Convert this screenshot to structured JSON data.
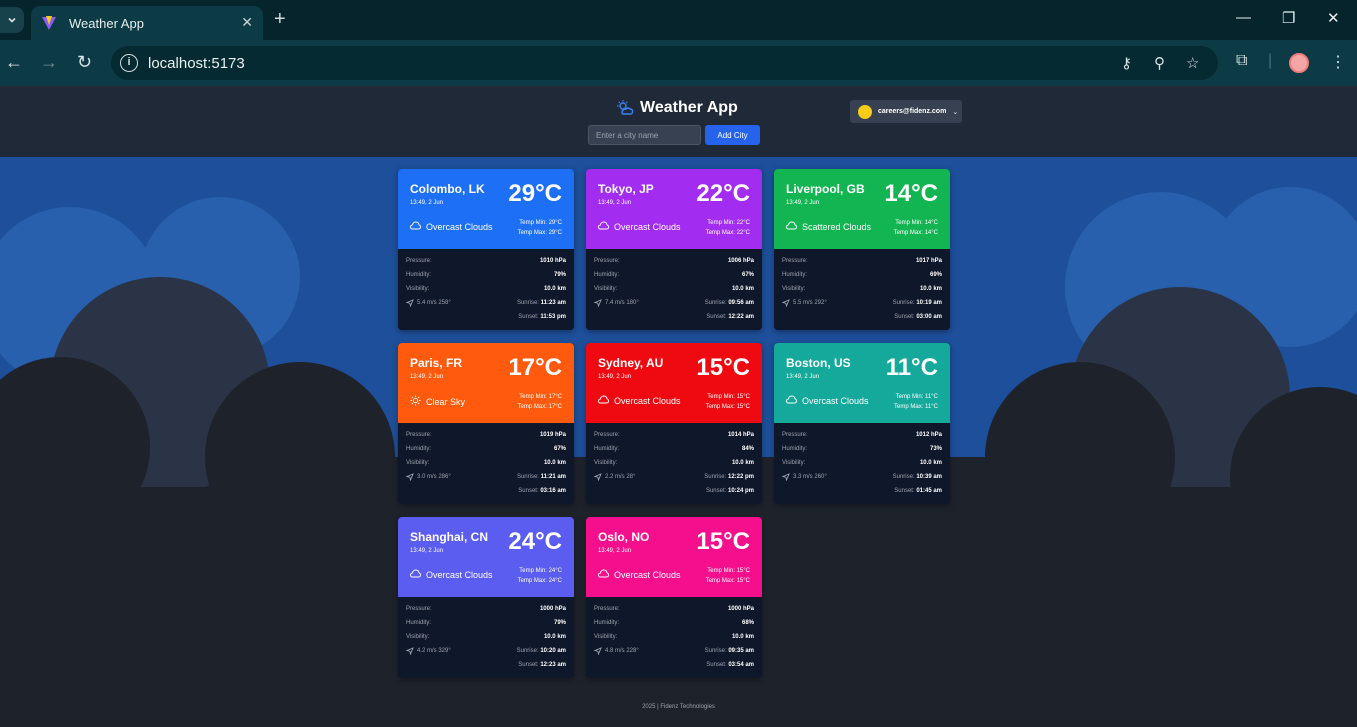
{
  "browser": {
    "tab_title": "Weather App",
    "url": "localhost:5173"
  },
  "app": {
    "title": "Weather App",
    "search_placeholder": "Enter a city name",
    "add_button": "Add City",
    "user_email": "careers@fidenz.com"
  },
  "labels": {
    "pressure": "Pressure:",
    "humidity": "Humidity:",
    "visibility": "Visibility:",
    "sunrise": "Sunrise:",
    "sunset": "Sunset:",
    "temp_min": "Temp Min:",
    "temp_max": "Temp Max:"
  },
  "cards": [
    {
      "city": "Colombo, LK",
      "time": "13:49, 2 Jun",
      "temp": "29°C",
      "condition": "Overcast Clouds",
      "icon": "cloud-icon",
      "temp_min": "29°C",
      "temp_max": "29°C",
      "pressure": "1010 hPa",
      "humidity": "79%",
      "visibility": "10.0 km",
      "wind": "5.4 m/s 258°",
      "sunrise": "11:23 am",
      "sunset": "11:53 pm",
      "color": "#1d6ff5"
    },
    {
      "city": "Tokyo, JP",
      "time": "13:49, 2 Jun",
      "temp": "22°C",
      "condition": "Overcast Clouds",
      "icon": "cloud-icon",
      "temp_min": "22°C",
      "temp_max": "22°C",
      "pressure": "1006 hPa",
      "humidity": "67%",
      "visibility": "10.0 km",
      "wind": "7.4 m/s 180°",
      "sunrise": "09:56 am",
      "sunset": "12:22 am",
      "color": "#a22cf0"
    },
    {
      "city": "Liverpool, GB",
      "time": "13:49, 2 Jun",
      "temp": "14°C",
      "condition": "Scattered Clouds",
      "icon": "cloud-icon",
      "temp_min": "14°C",
      "temp_max": "14°C",
      "pressure": "1017 hPa",
      "humidity": "69%",
      "visibility": "10.0 km",
      "wind": "5.5 m/s 292°",
      "sunrise": "10:19 am",
      "sunset": "03:00 am",
      "color": "#12b552"
    },
    {
      "city": "Paris, FR",
      "time": "13:49, 2 Jun",
      "temp": "17°C",
      "condition": "Clear Sky",
      "icon": "sun-icon",
      "temp_min": "17°C",
      "temp_max": "17°C",
      "pressure": "1019 hPa",
      "humidity": "67%",
      "visibility": "10.0 km",
      "wind": "3.0 m/s 286°",
      "sunrise": "11:21 am",
      "sunset": "03:16 am",
      "color": "#ff5a0d"
    },
    {
      "city": "Sydney, AU",
      "time": "13:49, 2 Jun",
      "temp": "15°C",
      "condition": "Overcast Clouds",
      "icon": "cloud-icon",
      "temp_min": "15°C",
      "temp_max": "15°C",
      "pressure": "1014 hPa",
      "humidity": "84%",
      "visibility": "10.0 km",
      "wind": "2.2 m/s 28°",
      "sunrise": "12:22 pm",
      "sunset": "10:24 pm",
      "color": "#ef0a12"
    },
    {
      "city": "Boston, US",
      "time": "13:49, 2 Jun",
      "temp": "11°C",
      "condition": "Overcast Clouds",
      "icon": "cloud-icon",
      "temp_min": "11°C",
      "temp_max": "11°C",
      "pressure": "1012 hPa",
      "humidity": "73%",
      "visibility": "10.0 km",
      "wind": "3.3 m/s 260°",
      "sunrise": "10:39 am",
      "sunset": "01:45 am",
      "color": "#14a99b"
    },
    {
      "city": "Shanghai, CN",
      "time": "13:49, 2 Jun",
      "temp": "24°C",
      "condition": "Overcast Clouds",
      "icon": "cloud-icon",
      "temp_min": "24°C",
      "temp_max": "24°C",
      "pressure": "1000 hPa",
      "humidity": "79%",
      "visibility": "10.0 km",
      "wind": "4.2 m/s 329°",
      "sunrise": "10:20 am",
      "sunset": "12:23 am",
      "color": "#5b5cf0"
    },
    {
      "city": "Oslo, NO",
      "time": "13:49, 2 Jun",
      "temp": "15°C",
      "condition": "Overcast Clouds",
      "icon": "cloud-icon",
      "temp_min": "15°C",
      "temp_max": "15°C",
      "pressure": "1000 hPa",
      "humidity": "68%",
      "visibility": "10.0 km",
      "wind": "4.8 m/s 228°",
      "sunrise": "09:35 am",
      "sunset": "03:54 am",
      "color": "#f50f8c"
    }
  ],
  "footer": "2025 | Fidenz Technologies"
}
